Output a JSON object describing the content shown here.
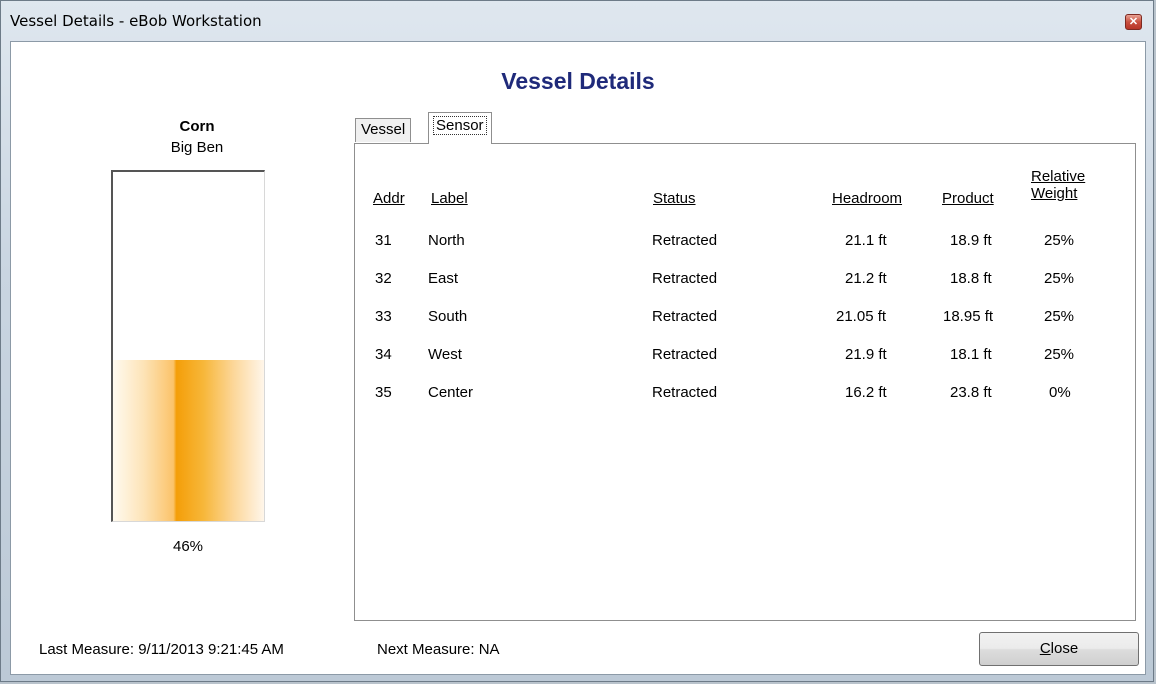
{
  "window": {
    "title": "Vessel Details - eBob Workstation",
    "close_glyph": "✕"
  },
  "heading": "Vessel Details",
  "vessel": {
    "product": "Corn",
    "name": "Big Ben",
    "fill_percent": 46,
    "fill_label": "46%",
    "fill_color": "#f49e08"
  },
  "tabs": [
    {
      "label": "Vessel",
      "selected": false
    },
    {
      "label": "Sensor",
      "selected": true
    }
  ],
  "sensor_table": {
    "headers": {
      "addr": "Addr",
      "label": "Label",
      "status": "Status",
      "headroom": "Headroom",
      "product": "Product",
      "weight_line1": "Relative",
      "weight_line2": "Weight"
    },
    "rows": [
      {
        "addr": "31",
        "label": "North",
        "status": "Retracted",
        "headroom": "21.1 ft",
        "product": "18.9 ft",
        "weight": "25%"
      },
      {
        "addr": "32",
        "label": "East",
        "status": "Retracted",
        "headroom": "21.2 ft",
        "product": "18.8 ft",
        "weight": "25%"
      },
      {
        "addr": "33",
        "label": "South",
        "status": "Retracted",
        "headroom": "21.05 ft",
        "product": "18.95 ft",
        "weight": "25%"
      },
      {
        "addr": "34",
        "label": "West",
        "status": "Retracted",
        "headroom": "21.9 ft",
        "product": "18.1 ft",
        "weight": "25%"
      },
      {
        "addr": "35",
        "label": "Center",
        "status": "Retracted",
        "headroom": "16.2 ft",
        "product": "23.8 ft",
        "weight": "0%"
      }
    ]
  },
  "footer": {
    "last_measure": "Last Measure: 9/11/2013 9:21:45 AM",
    "next_measure": "Next Measure: NA",
    "close_mnemonic": "C",
    "close_rest": "lose"
  }
}
